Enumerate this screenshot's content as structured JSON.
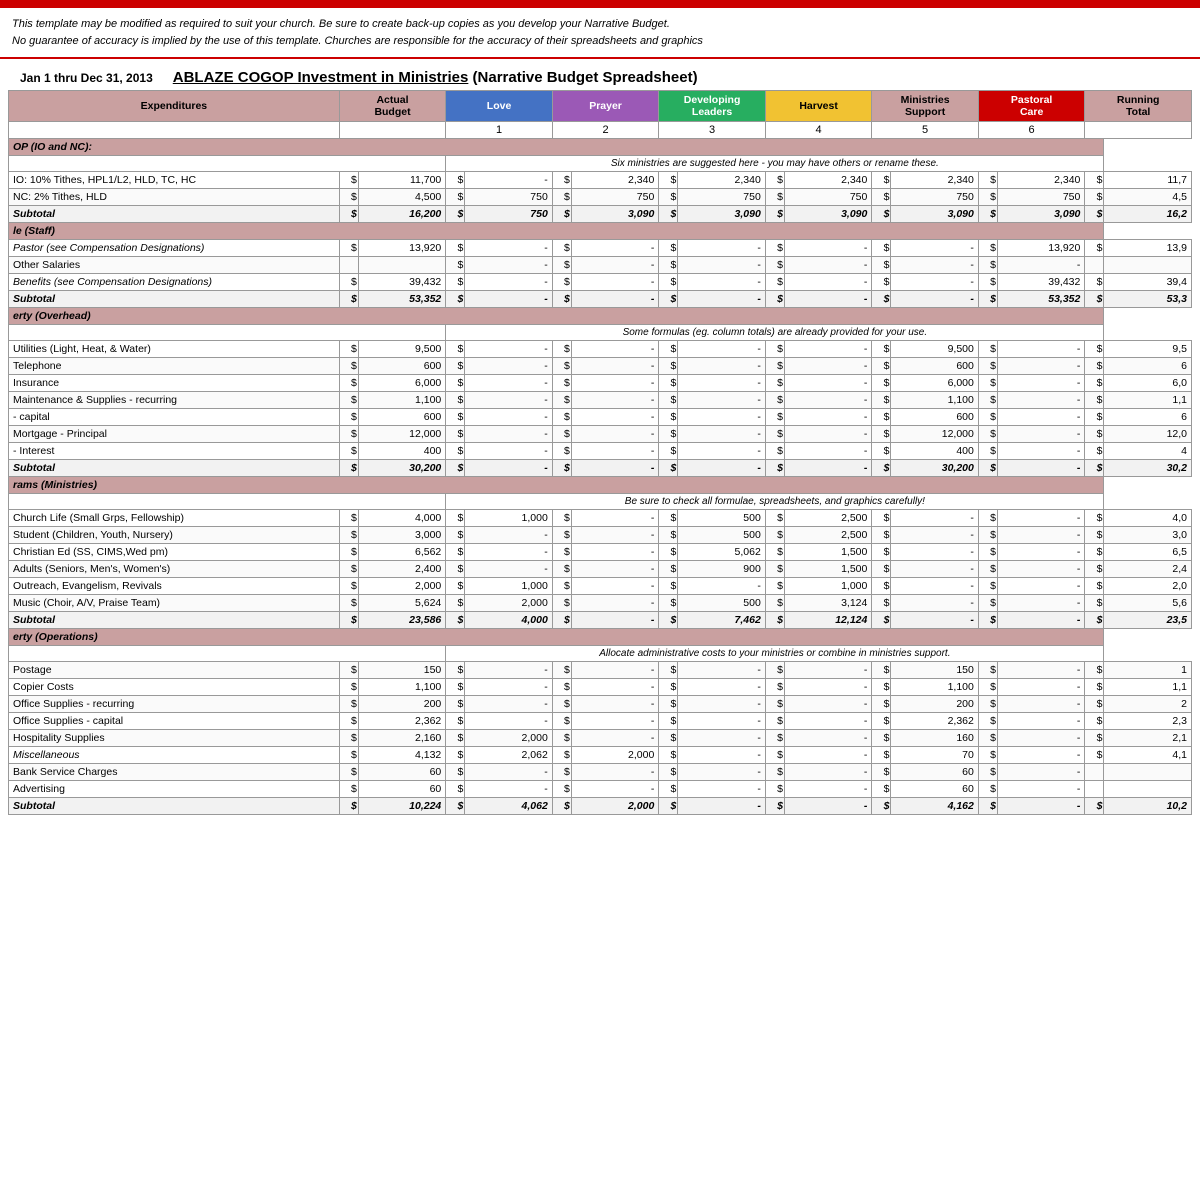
{
  "top": {
    "disclaimer_line1": "This template may be modified as required to suit your church.  Be sure to create back-up copies as you develop your Narrative Budget.",
    "disclaimer_line2": "No guarantee of accuracy is implied by the use of this template.  Churches are responsible for the accuracy of their spreadsheets and graphics",
    "date_range": "Jan 1 thru Dec 31, 2013",
    "title_underline": "ABLAZE COGOP  Investment in Ministries",
    "title_rest": " (Narrative Budget Spreadsheet)"
  },
  "headers": {
    "expenditures": "Expenditures",
    "actual_budget": [
      "Actual",
      "Budget"
    ],
    "love": "Love",
    "love_num": "1",
    "prayer": "Prayer",
    "prayer_num": "2",
    "developing": [
      "Developing",
      "Leaders"
    ],
    "developing_num": "3",
    "harvest": "Harvest",
    "harvest_num": "4",
    "ministries": [
      "Ministries",
      "Support"
    ],
    "ministries_num": "5",
    "pastoral": [
      "Pastoral",
      "Care"
    ],
    "pastoral_num": "6",
    "running": [
      "Running",
      "Total"
    ]
  },
  "sections": [
    {
      "title": "OP (IO and NC):",
      "notice": "Six ministries are suggested here - you may have others or rename these.",
      "rows": [
        {
          "label": "IO: 10% Tithes, HPL1/L2, HLD, TC, HC",
          "actual": "11,700",
          "love": "-",
          "prayer": "2,340",
          "developing": "2,340",
          "harvest": "2,340",
          "ministries": "2,340",
          "pastoral": "2,340",
          "running": "11,7"
        },
        {
          "label": "NC: 2% Tithes, HLD",
          "actual": "4,500",
          "love": "750",
          "prayer": "750",
          "developing": "750",
          "harvest": "750",
          "ministries": "750",
          "pastoral": "750",
          "running": "4,5"
        },
        {
          "label": "Subtotal",
          "actual": "16,200",
          "love": "750",
          "prayer": "3,090",
          "developing": "3,090",
          "harvest": "3,090",
          "ministries": "3,090",
          "pastoral": "3,090",
          "running": "16,2",
          "subtotal": true
        }
      ]
    },
    {
      "title": "le (Staff)",
      "notice": null,
      "rows": [
        {
          "label": "Pastor (see Compensation Designations)",
          "actual": "13,920",
          "love": "-",
          "prayer": "-",
          "developing": "-",
          "harvest": "-",
          "ministries": "-",
          "pastoral": "13,920",
          "running": "13,9",
          "italic_label": true
        },
        {
          "label": "Other Salaries",
          "actual": "",
          "love": "-",
          "prayer": "-",
          "developing": "-",
          "harvest": "-",
          "ministries": "-",
          "pastoral": "-",
          "running": ""
        },
        {
          "label": "Benefits (see Compensation Designations)",
          "actual": "39,432",
          "love": "-",
          "prayer": "-",
          "developing": "-",
          "harvest": "-",
          "ministries": "-",
          "pastoral": "39,432",
          "running": "39,4",
          "italic_label": true
        },
        {
          "label": "Subtotal",
          "actual": "53,352",
          "love": "-",
          "prayer": "-",
          "developing": "-",
          "harvest": "-",
          "ministries": "-",
          "pastoral": "53,352",
          "running": "53,3",
          "subtotal": true
        }
      ]
    },
    {
      "title": "erty (Overhead)",
      "notice": "Some formulas (eg. column totals) are already provided for your use.",
      "rows": [
        {
          "label": "Utilities (Light, Heat, & Water)",
          "actual": "9,500",
          "love": "-",
          "prayer": "-",
          "developing": "-",
          "harvest": "-",
          "ministries": "9,500",
          "pastoral": "-",
          "running": "9,5"
        },
        {
          "label": "Telephone",
          "actual": "600",
          "love": "-",
          "prayer": "-",
          "developing": "-",
          "harvest": "-",
          "ministries": "600",
          "pastoral": "-",
          "running": "6"
        },
        {
          "label": "Insurance",
          "actual": "6,000",
          "love": "-",
          "prayer": "-",
          "developing": "-",
          "harvest": "-",
          "ministries": "6,000",
          "pastoral": "-",
          "running": "6,0"
        },
        {
          "label": "Maintenance & Supplies - recurring",
          "actual": "1,100",
          "love": "-",
          "prayer": "-",
          "developing": "-",
          "harvest": "-",
          "ministries": "1,100",
          "pastoral": "-",
          "running": "1,1"
        },
        {
          "label": "- capital",
          "actual": "600",
          "love": "-",
          "prayer": "-",
          "developing": "-",
          "harvest": "-",
          "ministries": "600",
          "pastoral": "-",
          "running": "6"
        },
        {
          "label": "Mortgage  - Principal",
          "actual": "12,000",
          "love": "-",
          "prayer": "-",
          "developing": "-",
          "harvest": "-",
          "ministries": "12,000",
          "pastoral": "-",
          "running": "12,0"
        },
        {
          "label": "- Interest",
          "actual": "400",
          "love": "-",
          "prayer": "-",
          "developing": "-",
          "harvest": "-",
          "ministries": "400",
          "pastoral": "-",
          "running": "4"
        },
        {
          "label": "Subtotal",
          "actual": "30,200",
          "love": "-",
          "prayer": "-",
          "developing": "-",
          "harvest": "-",
          "ministries": "30,200",
          "pastoral": "-",
          "running": "30,2",
          "subtotal": true
        }
      ]
    },
    {
      "title": "rams (Ministries)",
      "notice": "Be sure to check all formulae, spreadsheets, and graphics carefully!",
      "rows": [
        {
          "label": "Church Life (Small Grps, Fellowship)",
          "actual": "4,000",
          "love": "1,000",
          "prayer": "-",
          "developing": "500",
          "harvest": "2,500",
          "ministries": "-",
          "pastoral": "-",
          "running": "4,0"
        },
        {
          "label": "Student (Children, Youth, Nursery)",
          "actual": "3,000",
          "love": "-",
          "prayer": "-",
          "developing": "500",
          "harvest": "2,500",
          "ministries": "-",
          "pastoral": "-",
          "running": "3,0"
        },
        {
          "label": "Christian Ed (SS, CIMS,Wed pm)",
          "actual": "6,562",
          "love": "-",
          "prayer": "-",
          "developing": "5,062",
          "harvest": "1,500",
          "ministries": "-",
          "pastoral": "-",
          "running": "6,5"
        },
        {
          "label": "Adults (Seniors, Men's, Women's)",
          "actual": "2,400",
          "love": "-",
          "prayer": "-",
          "developing": "900",
          "harvest": "1,500",
          "ministries": "-",
          "pastoral": "-",
          "running": "2,4"
        },
        {
          "label": "Outreach, Evangelism, Revivals",
          "actual": "2,000",
          "love": "1,000",
          "prayer": "-",
          "developing": "-",
          "harvest": "1,000",
          "ministries": "-",
          "pastoral": "-",
          "running": "2,0"
        },
        {
          "label": "Music (Choir, A/V, Praise Team)",
          "actual": "5,624",
          "love": "2,000",
          "prayer": "-",
          "developing": "500",
          "harvest": "3,124",
          "ministries": "-",
          "pastoral": "-",
          "running": "5,6"
        },
        {
          "label": "Subtotal",
          "actual": "23,586",
          "love": "4,000",
          "prayer": "-",
          "developing": "7,462",
          "harvest": "12,124",
          "ministries": "-",
          "pastoral": "-",
          "running": "23,5",
          "subtotal": true
        }
      ]
    },
    {
      "title": "erty (Operations)",
      "notice": "Allocate administrative costs to your ministries or combine in ministries support.",
      "rows": [
        {
          "label": "Postage",
          "actual": "150",
          "love": "-",
          "prayer": "-",
          "developing": "-",
          "harvest": "-",
          "ministries": "150",
          "pastoral": "-",
          "running": "1"
        },
        {
          "label": "Copier Costs",
          "actual": "1,100",
          "love": "-",
          "prayer": "-",
          "developing": "-",
          "harvest": "-",
          "ministries": "1,100",
          "pastoral": "-",
          "running": "1,1"
        },
        {
          "label": "Office Supplies - recurring",
          "actual": "200",
          "love": "-",
          "prayer": "-",
          "developing": "-",
          "harvest": "-",
          "ministries": "200",
          "pastoral": "-",
          "running": "2"
        },
        {
          "label": "Office Supplies - capital",
          "actual": "2,362",
          "love": "-",
          "prayer": "-",
          "developing": "-",
          "harvest": "-",
          "ministries": "2,362",
          "pastoral": "-",
          "running": "2,3"
        },
        {
          "label": "Hospitality Supplies",
          "actual": "2,160",
          "love": "2,000",
          "prayer": "-",
          "developing": "-",
          "harvest": "-",
          "ministries": "160",
          "pastoral": "-",
          "running": "2,1"
        },
        {
          "label": "Miscellaneous",
          "actual": "4,132",
          "love": "2,062",
          "prayer": "2,000",
          "developing": "-",
          "harvest": "-",
          "ministries": "70",
          "pastoral": "-",
          "running": "4,1",
          "italic_label": true
        },
        {
          "label": "Bank Service Charges",
          "actual": "60",
          "love": "-",
          "prayer": "-",
          "developing": "-",
          "harvest": "-",
          "ministries": "60",
          "pastoral": "-",
          "running": ""
        },
        {
          "label": "Advertising",
          "actual": "60",
          "love": "-",
          "prayer": "-",
          "developing": "-",
          "harvest": "-",
          "ministries": "60",
          "pastoral": "-",
          "running": ""
        },
        {
          "label": "Subtotal",
          "actual": "10,224",
          "love": "4,062",
          "prayer": "2,000",
          "developing": "-",
          "harvest": "-",
          "ministries": "4,162",
          "pastoral": "-",
          "running": "10,2",
          "subtotal": true
        }
      ]
    }
  ]
}
